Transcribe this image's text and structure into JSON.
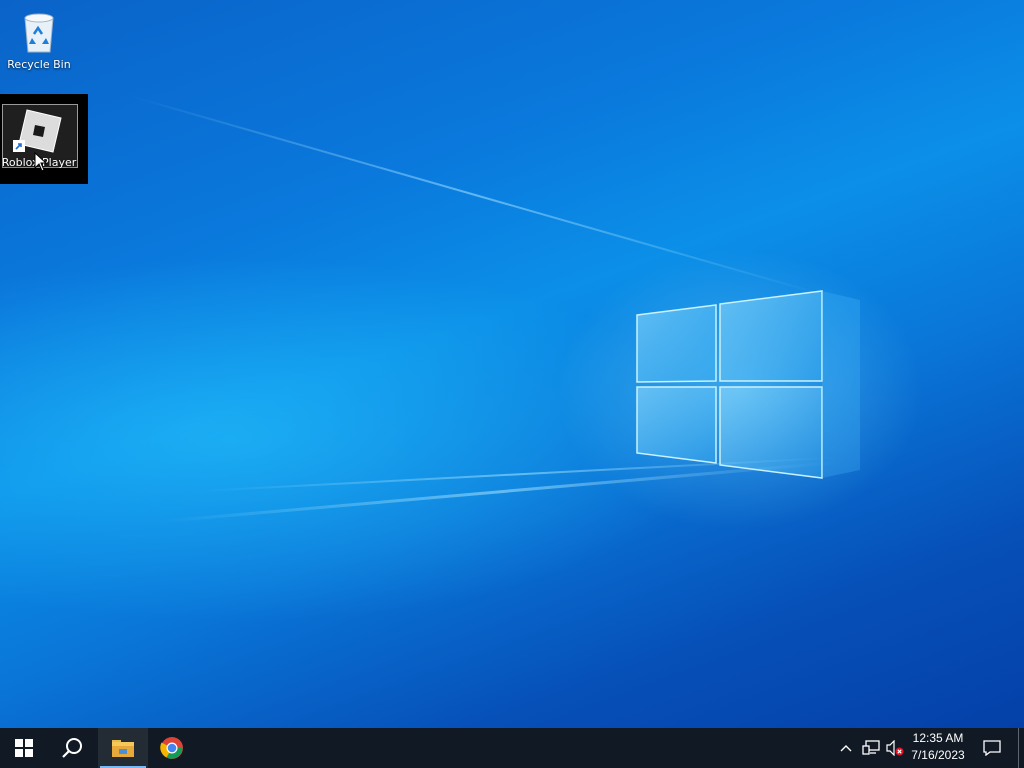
{
  "desktop": {
    "icons": [
      {
        "label": "Recycle Bin",
        "icon": "recycle-bin-icon"
      },
      {
        "label": "Roblox Player",
        "icon": "roblox-player-icon",
        "selected": true
      }
    ]
  },
  "taskbar": {
    "start_icon": "windows-start-icon",
    "search_icon": "search-icon",
    "pinned": [
      {
        "name": "File Explorer",
        "icon": "file-explorer-icon",
        "active": true
      },
      {
        "name": "Google Chrome",
        "icon": "chrome-icon",
        "active": false
      }
    ],
    "tray": {
      "chevron_icon": "show-hidden-icons-chevron-icon",
      "network_icon": "network-icon",
      "volume_icon": "volume-muted-icon",
      "time": "12:35 AM",
      "date": "7/16/2023",
      "notification_icon": "action-center-icon"
    }
  },
  "colors": {
    "taskbar": "#111a24",
    "wallpaper_primary": "#0a78dc",
    "wallpaper_dark": "#0440a8",
    "selection_frame": "#000000"
  }
}
